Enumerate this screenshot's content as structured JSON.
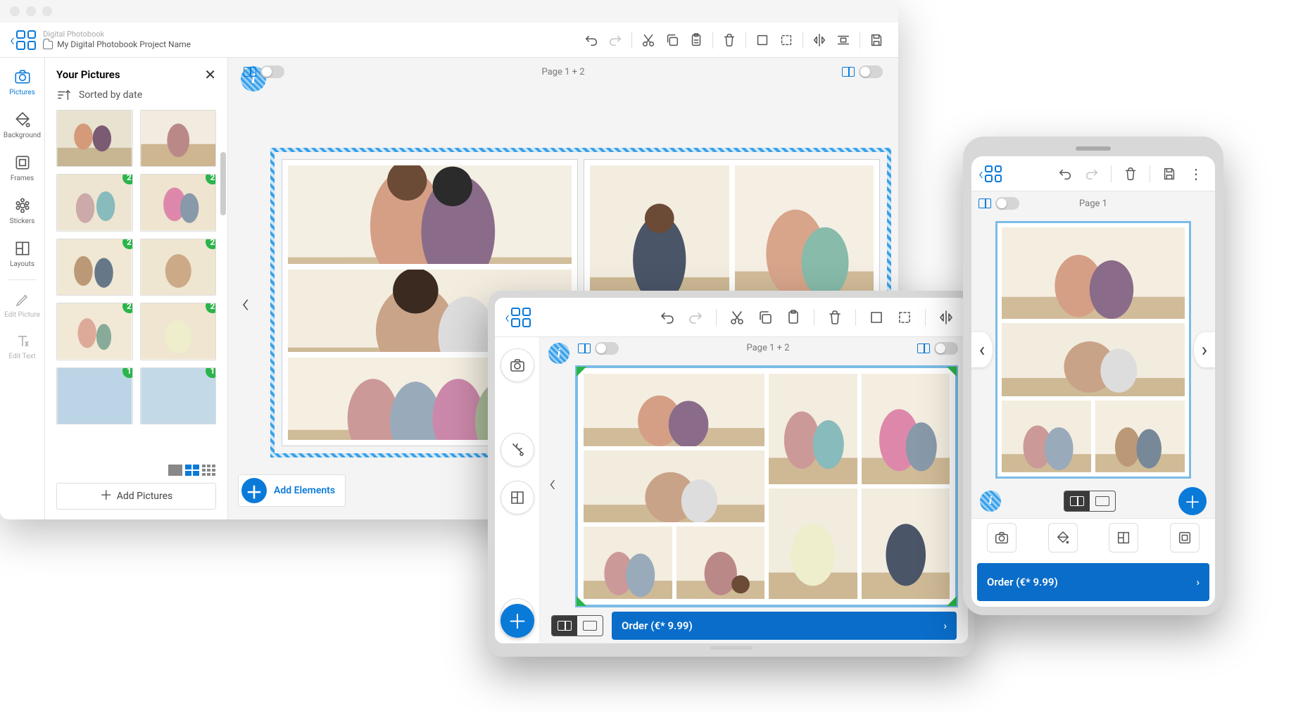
{
  "breadcrumb_top": "Digital Photobook",
  "breadcrumb_project": "My Digital Photobook Project Name",
  "sidebar": {
    "pictures": "Pictures",
    "background": "Background",
    "frames": "Frames",
    "stickers": "Stickers",
    "layouts": "Layouts",
    "edit_picture": "Edit Picture",
    "edit_text": "Edit Text"
  },
  "panel": {
    "title": "Your Pictures",
    "sort_label": "Sorted by date",
    "add_pictures": "Add Pictures",
    "badges": [
      "2",
      "2",
      "2",
      "2",
      "2",
      "2",
      "1",
      "1"
    ]
  },
  "canvas": {
    "page_label_spread": "Page 1 + 2",
    "page_label_single": "Page 1",
    "add_elements": "Add Elements"
  },
  "order": {
    "label": "Order (€* 9.99)"
  }
}
